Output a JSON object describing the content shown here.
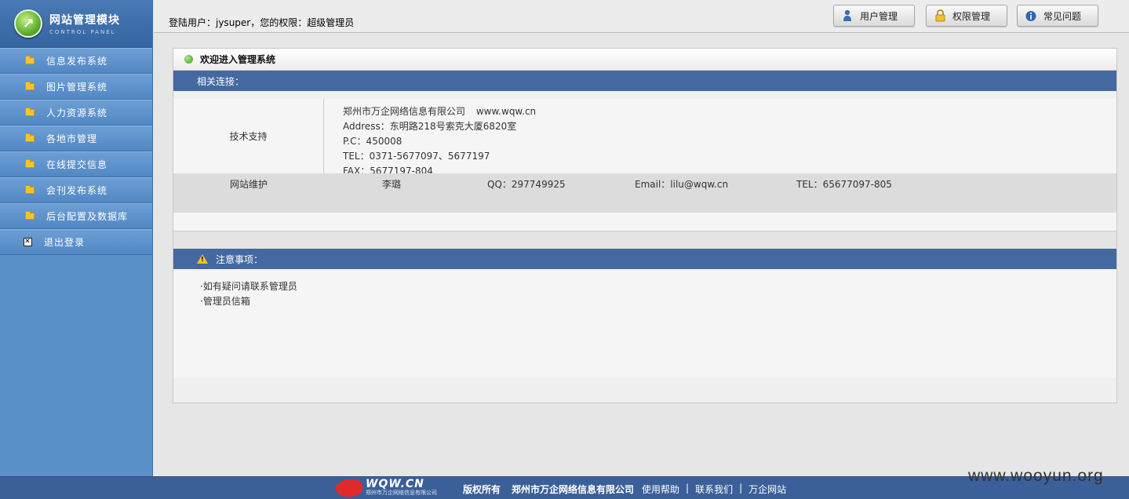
{
  "logo": {
    "title": "网站管理模块",
    "subtitle": "CONTROL PANEL"
  },
  "sidebar": {
    "items": [
      {
        "label": "信息发布系统",
        "icon": "folder-icon"
      },
      {
        "label": "图片管理系统",
        "icon": "folder-icon"
      },
      {
        "label": "人力资源系统",
        "icon": "folder-icon"
      },
      {
        "label": "各地市管理",
        "icon": "folder-icon"
      },
      {
        "label": "在线提交信息",
        "icon": "folder-icon"
      },
      {
        "label": "会刊发布系统",
        "icon": "folder-icon"
      },
      {
        "label": "后台配置及数据库",
        "icon": "folder-icon"
      }
    ],
    "logout": {
      "label": "退出登录",
      "icon": "close-box-icon"
    }
  },
  "header": {
    "login_info": "登陆用户：jysuper，您的权限：超级管理员",
    "buttons": {
      "user": "用户管理",
      "perm": "权限管理",
      "faq": "常见问题"
    }
  },
  "content": {
    "welcome": "欢迎进入管理系统",
    "links_title": "相关连接：",
    "support": {
      "label": "技术支持",
      "company": "郑州市万企网络信息有限公司",
      "website": "www.wqw.cn",
      "address": "Address：东明路218号索克大厦6820室",
      "pc": "P.C：450008",
      "tel": "TEL：0371-5677097、5677197",
      "fax": "FAX：5677197-804"
    },
    "maintenance": {
      "label": "网站维护",
      "name": "李璐",
      "qq": "QQ：297749925",
      "email": "Email：lilu@wqw.cn",
      "tel": "TEL：65677097-805"
    },
    "notes_title": "注意事项：",
    "notes": [
      "·如有疑问请联系管理员",
      "·管理员信箱"
    ]
  },
  "footer": {
    "brand": "WQW.CN",
    "brand_sub": "郑州市万企网络信息有限公司",
    "copyright": "版权所有",
    "company": "郑州市万企网络信息有限公司",
    "links": [
      "使用帮助",
      "联系我们",
      "万企网站"
    ],
    "separator": "|"
  },
  "watermark": "www.wooyun.org",
  "colors": {
    "sidebar": "#5b8fc7",
    "section_bar": "#4469a0",
    "footer": "#3b5f99"
  }
}
